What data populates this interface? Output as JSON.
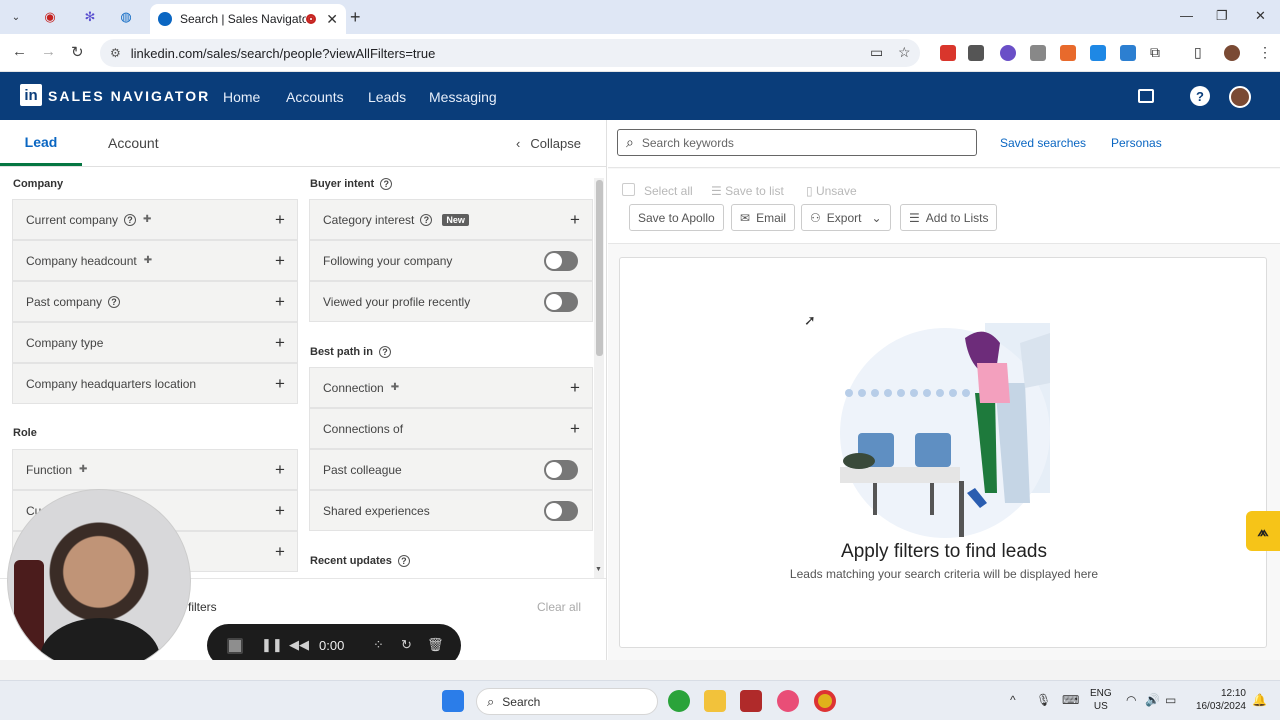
{
  "browser": {
    "active_tab_title": "Search | Sales Navigator",
    "url": "linkedin.com/sales/search/people?viewAllFilters=true"
  },
  "header": {
    "logo": "in",
    "brand": "SALES NAVIGATOR",
    "nav": [
      "Home",
      "Accounts",
      "Leads",
      "Messaging"
    ],
    "help": "?"
  },
  "left": {
    "tab_lead": "Lead",
    "tab_account": "Account",
    "collapse": "Collapse",
    "company_heading": "Company",
    "company_filters": [
      "Current company",
      "Company headcount",
      "Past company",
      "Company type",
      "Company headquarters location"
    ],
    "role_heading": "Role",
    "role_filters": [
      "Function",
      "Cu",
      ""
    ],
    "buyer_heading": "Buyer intent",
    "buyer_items": [
      "Category interest",
      "Following your company",
      "Viewed your profile recently"
    ],
    "new_badge": "New",
    "bestpath_heading": "Best path in",
    "bestpath_items": [
      "Connection",
      "Connections of",
      "Past colleague",
      "Shared experiences"
    ],
    "recent_heading": "Recent updates",
    "filters_label": "filters",
    "clear_all": "Clear all"
  },
  "recorder": {
    "time": "0:00"
  },
  "right": {
    "search_placeholder": "Search keywords",
    "saved_searches": "Saved searches",
    "personas": "Personas",
    "select_all": "Select all",
    "save_to_list": "Save to list",
    "unsave": "Unsave",
    "save_to_apollo": "Save to Apollo",
    "email": "Email",
    "export": "Export",
    "add_to_lists": "Add to Lists",
    "empty_title": "Apply filters to find leads",
    "empty_subtitle": "Leads matching your search criteria will be displayed here"
  },
  "taskbar": {
    "search": "Search",
    "lang_line1": "ENG",
    "lang_line2": "US",
    "time": "12:10",
    "date": "16/03/2024"
  },
  "colors": {
    "brand_blue": "#0a3d7a",
    "link_blue": "#0a66c2",
    "accent_green": "#057642"
  }
}
